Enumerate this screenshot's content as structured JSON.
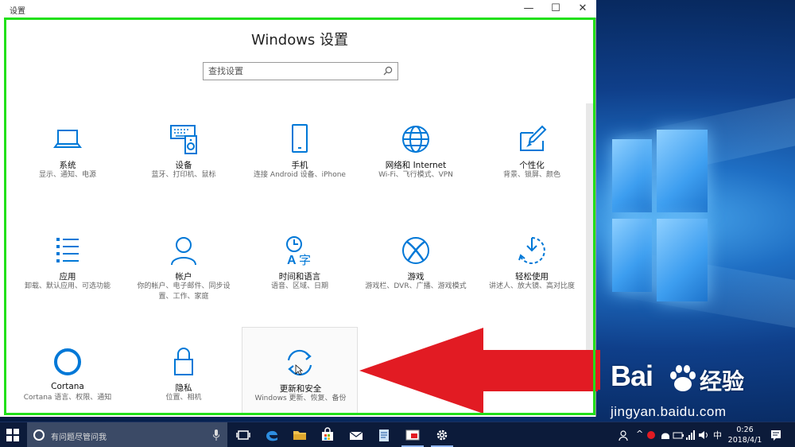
{
  "window": {
    "title": "设置",
    "controls": {
      "minimize": "—",
      "maximize": "☐",
      "close": "✕"
    },
    "heading": "Windows 设置"
  },
  "search": {
    "placeholder": "查找设置"
  },
  "tiles": [
    {
      "name": "系统",
      "desc": "显示、通知、电源",
      "icon": "laptop-icon"
    },
    {
      "name": "设备",
      "desc": "蓝牙、打印机、鼠标",
      "icon": "devices-icon"
    },
    {
      "name": "手机",
      "desc": "连接 Android 设备、iPhone",
      "icon": "phone-icon"
    },
    {
      "name": "网络和 Internet",
      "desc": "Wi-Fi、飞行模式、VPN",
      "icon": "globe-icon"
    },
    {
      "name": "个性化",
      "desc": "背景、锁屏、颜色",
      "icon": "paintbrush-icon"
    },
    {
      "name": "应用",
      "desc": "卸载、默认应用、可选功能",
      "icon": "apps-list-icon"
    },
    {
      "name": "帐户",
      "desc": "你的帐户、电子邮件、同步设置、工作、家庭",
      "icon": "person-icon"
    },
    {
      "name": "时间和语言",
      "desc": "语音、区域、日期",
      "icon": "time-language-icon"
    },
    {
      "name": "游戏",
      "desc": "游戏栏、DVR、广播、游戏模式",
      "icon": "xbox-icon"
    },
    {
      "name": "轻松使用",
      "desc": "讲述人、放大镜、高对比度",
      "icon": "ease-of-access-icon"
    },
    {
      "name": "Cortana",
      "desc": "Cortana 语言、权限、通知",
      "icon": "cortana-icon"
    },
    {
      "name": "隐私",
      "desc": "位置、相机",
      "icon": "lock-icon"
    },
    {
      "name": "更新和安全",
      "desc": "Windows 更新、恢复、备份",
      "icon": "sync-icon"
    }
  ],
  "taskbar": {
    "search_text": "有问题尽管问我",
    "tray_ime": "中",
    "time": "0:26",
    "date": "2018/4/1"
  },
  "watermark": {
    "brand": "Bai",
    "suffix": "经验",
    "url": "jingyan.baidu.com"
  },
  "colors": {
    "accent": "#0078d7",
    "highlight_frame": "#22e01a",
    "arrow": "#e21b23"
  }
}
